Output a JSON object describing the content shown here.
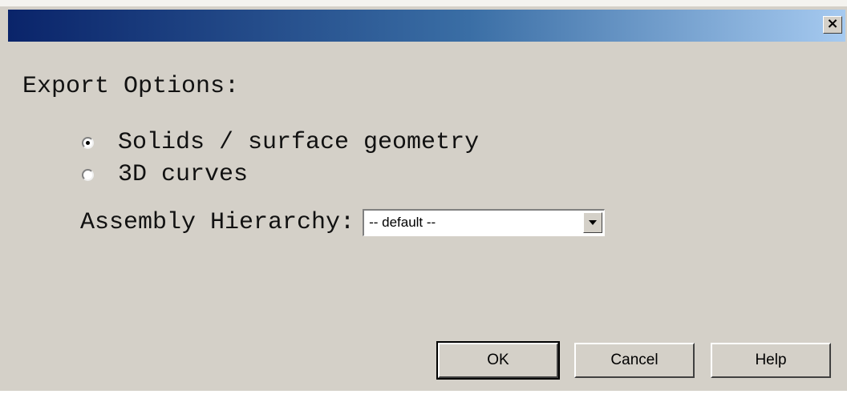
{
  "dialog": {
    "title": "",
    "close_label": "×"
  },
  "export_options": {
    "heading": "Export Options:",
    "options": [
      {
        "label": "Solids / surface geometry",
        "selected": true
      },
      {
        "label": "3D curves",
        "selected": false
      }
    ]
  },
  "assembly": {
    "label": "Assembly Hierarchy:",
    "selected_value": "-- default --"
  },
  "buttons": {
    "ok": "OK",
    "cancel": "Cancel",
    "help": "Help"
  },
  "colors": {
    "titlebar_start": "#0a246a",
    "titlebar_end": "#a6caf0",
    "dialog_bg": "#d4d0c8"
  }
}
